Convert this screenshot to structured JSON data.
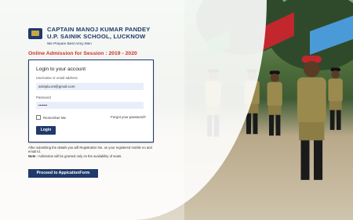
{
  "header": {
    "school_line1": "CAPTAIN MANOJ KUMAR PANDEY",
    "school_line2": "U.P. SAINIK SCHOOL, LUCKNOW",
    "motto": "We Prepare Best Army Men"
  },
  "session_title": "Online Admission for Session : 2019 - 2020",
  "login": {
    "title": "Login to your account",
    "username_label": "Username or email address",
    "username_value": "amitpla.iet@gmail.com",
    "password_label": "Password",
    "password_value": "•••••••",
    "remember_label": "Remember Me",
    "forgot_label": "Forgot your password?",
    "login_button": "Login"
  },
  "info": {
    "line1": "After submitting the details you will Registration No. on your registered mobile no and email Id.",
    "note_label": "Note :",
    "note_text": "Admission will be granted only on the availability of seats."
  },
  "proceed_button": "Proceed to AppicationForm",
  "colors": {
    "navy": "#1f3a6b",
    "session_red": "#d0342c"
  }
}
